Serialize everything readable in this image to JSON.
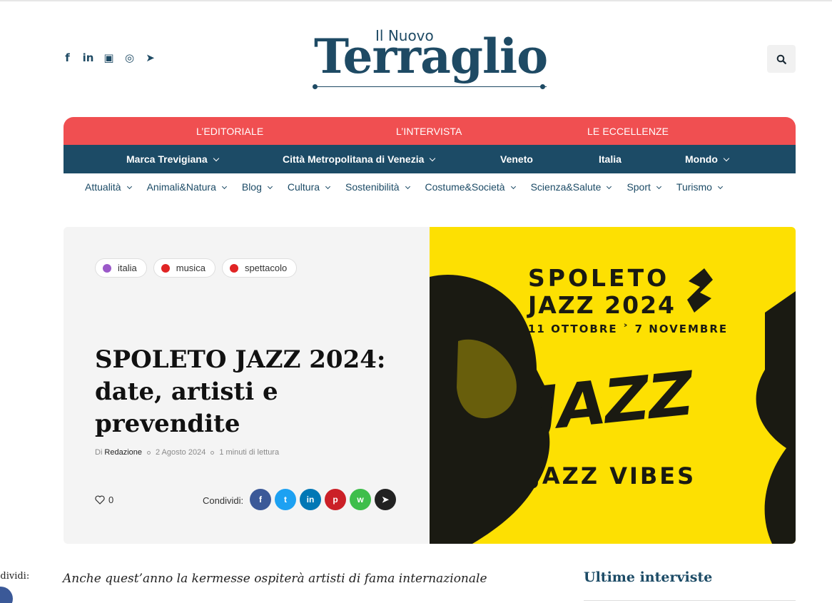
{
  "site": {
    "logo_small": "Il Nuovo",
    "logo_big": "Terraglio",
    "brand_colors": {
      "navy": "#1c4b66",
      "red": "#f04f51",
      "poster_yellow": "#fde002"
    }
  },
  "header": {
    "socials": [
      {
        "icon": "facebook-icon",
        "glyph": "f"
      },
      {
        "icon": "linkedin-icon",
        "glyph": "in"
      },
      {
        "icon": "youtube-icon",
        "glyph": "▣"
      },
      {
        "icon": "instagram-icon",
        "glyph": "◎"
      },
      {
        "icon": "telegram-icon",
        "glyph": "➤"
      }
    ],
    "search_icon": "search-icon"
  },
  "nav": {
    "primary": [
      "L’EDITORIALE",
      "L’INTERVISTA",
      "LE ECCELLENZE"
    ],
    "secondary": [
      {
        "label": "Marca Trevigiana",
        "dropdown": true
      },
      {
        "label": "Città Metropolitana di Venezia",
        "dropdown": true
      },
      {
        "label": "Veneto",
        "dropdown": false
      },
      {
        "label": "Italia",
        "dropdown": false
      },
      {
        "label": "Mondo",
        "dropdown": true
      }
    ],
    "categories": [
      "Attualità",
      "Animali&Natura",
      "Blog",
      "Cultura",
      "Sostenibilità",
      "Costume&Società",
      "Scienza&Salute",
      "Sport",
      "Turismo"
    ]
  },
  "article": {
    "tags": [
      {
        "label": "italia",
        "color": "#9b59c9"
      },
      {
        "label": "musica",
        "color": "#e02424"
      },
      {
        "label": "spettacolo",
        "color": "#e02424"
      }
    ],
    "title": "SPOLETO JAZZ 2024: date, artisti e prevendite",
    "author_prefix": "Di",
    "author": "Redazione",
    "date": "2 Agosto 2024",
    "reading_time": "1 minuti di lettura",
    "likes": "0",
    "share_label": "Condividi:",
    "share_buttons": [
      {
        "icon": "facebook-icon",
        "glyph": "f",
        "color": "#3b5998"
      },
      {
        "icon": "twitter-icon",
        "glyph": "t",
        "color": "#1da1f2"
      },
      {
        "icon": "linkedin-icon",
        "glyph": "in",
        "color": "#0077b5"
      },
      {
        "icon": "pinterest-icon",
        "glyph": "p",
        "color": "#cb2027"
      },
      {
        "icon": "whatsapp-icon",
        "glyph": "w",
        "color": "#3ebe4b"
      },
      {
        "icon": "telegram-icon",
        "glyph": "➤",
        "color": "#222222"
      }
    ],
    "image": {
      "line1": "SPOLETO",
      "line2": "JAZZ 2024",
      "dates": "11 OTTOBRE ˃ 7 NOVEMBRE",
      "word": "JAZZ",
      "footer": "JAZZ VIBES"
    },
    "lead": "Anche quest’anno la kermesse ospiterà artisti di fama internazionale"
  },
  "sidebar": {
    "share_label": "ndividi:",
    "section_title": "Ultime interviste"
  }
}
